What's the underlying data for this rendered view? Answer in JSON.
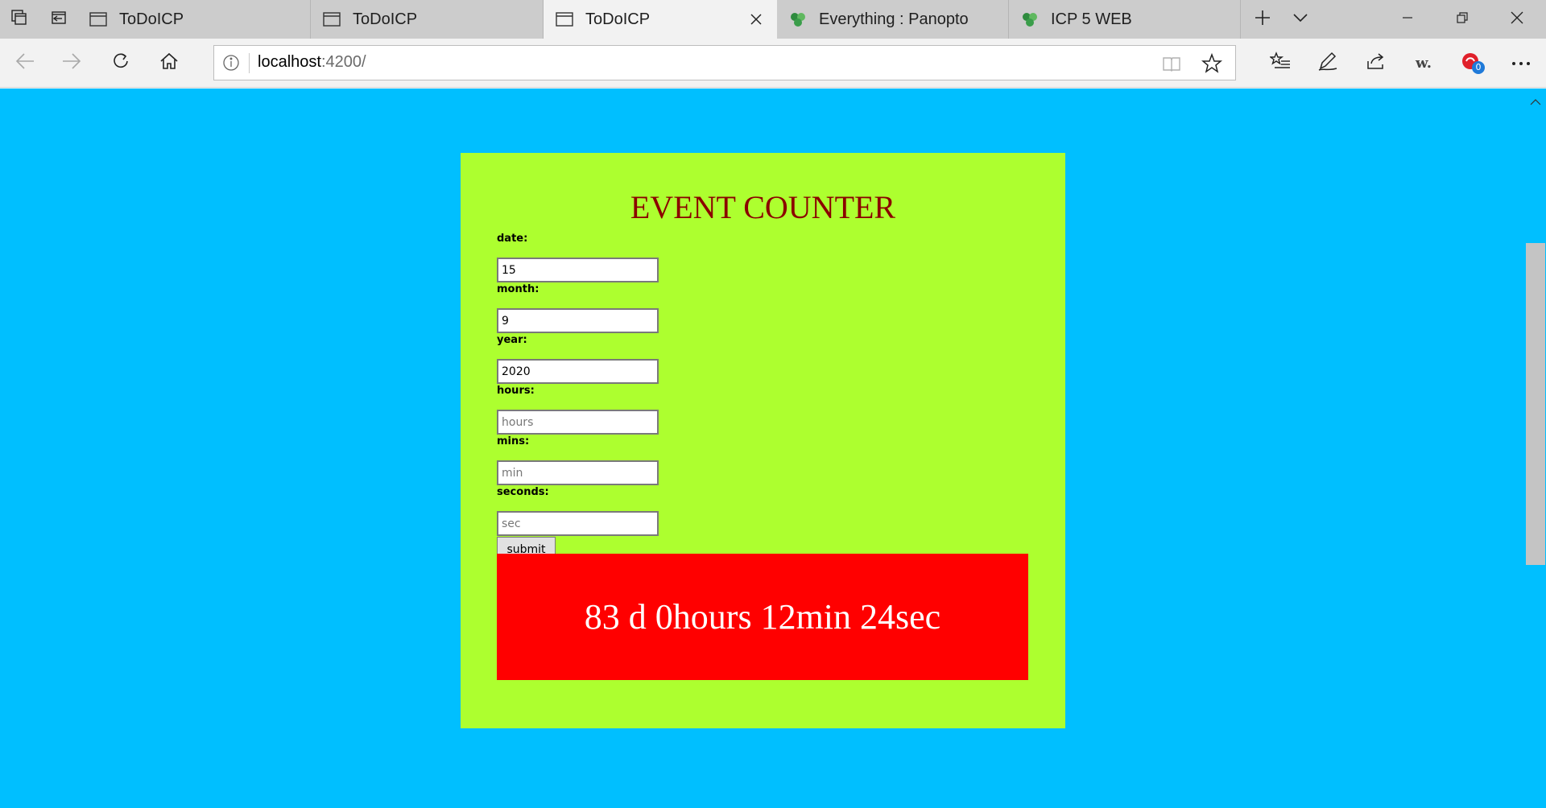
{
  "browser": {
    "tabs": [
      {
        "title": "ToDoICP",
        "active": false,
        "icon": "page-icon"
      },
      {
        "title": "ToDoICP",
        "active": false,
        "icon": "page-icon"
      },
      {
        "title": "ToDoICP",
        "active": true,
        "icon": "page-icon"
      },
      {
        "title": "Everything : Panopto",
        "active": false,
        "icon": "panopto-icon"
      },
      {
        "title": "ICP 5 WEB",
        "active": false,
        "icon": "panopto-icon"
      }
    ],
    "address": {
      "host": "localhost",
      "path": ":4200/"
    },
    "extension_badge": "0",
    "extension_label": "w."
  },
  "page": {
    "background": "#00bfff",
    "card_color": "#adff2f",
    "title": "EVENT COUNTER",
    "title_color": "#8b0000",
    "fields": [
      {
        "label": "date:",
        "value": "15",
        "placeholder": ""
      },
      {
        "label": "month:",
        "value": "9",
        "placeholder": ""
      },
      {
        "label": "year:",
        "value": "2020",
        "placeholder": ""
      },
      {
        "label": "hours:",
        "value": "",
        "placeholder": "hours"
      },
      {
        "label": "mins:",
        "value": "",
        "placeholder": "min"
      },
      {
        "label": "seconds:",
        "value": "",
        "placeholder": "sec"
      }
    ],
    "submit_label": "submit",
    "result_text": "83 d 0hours 12min 24sec",
    "result_color": "#ff0000"
  }
}
